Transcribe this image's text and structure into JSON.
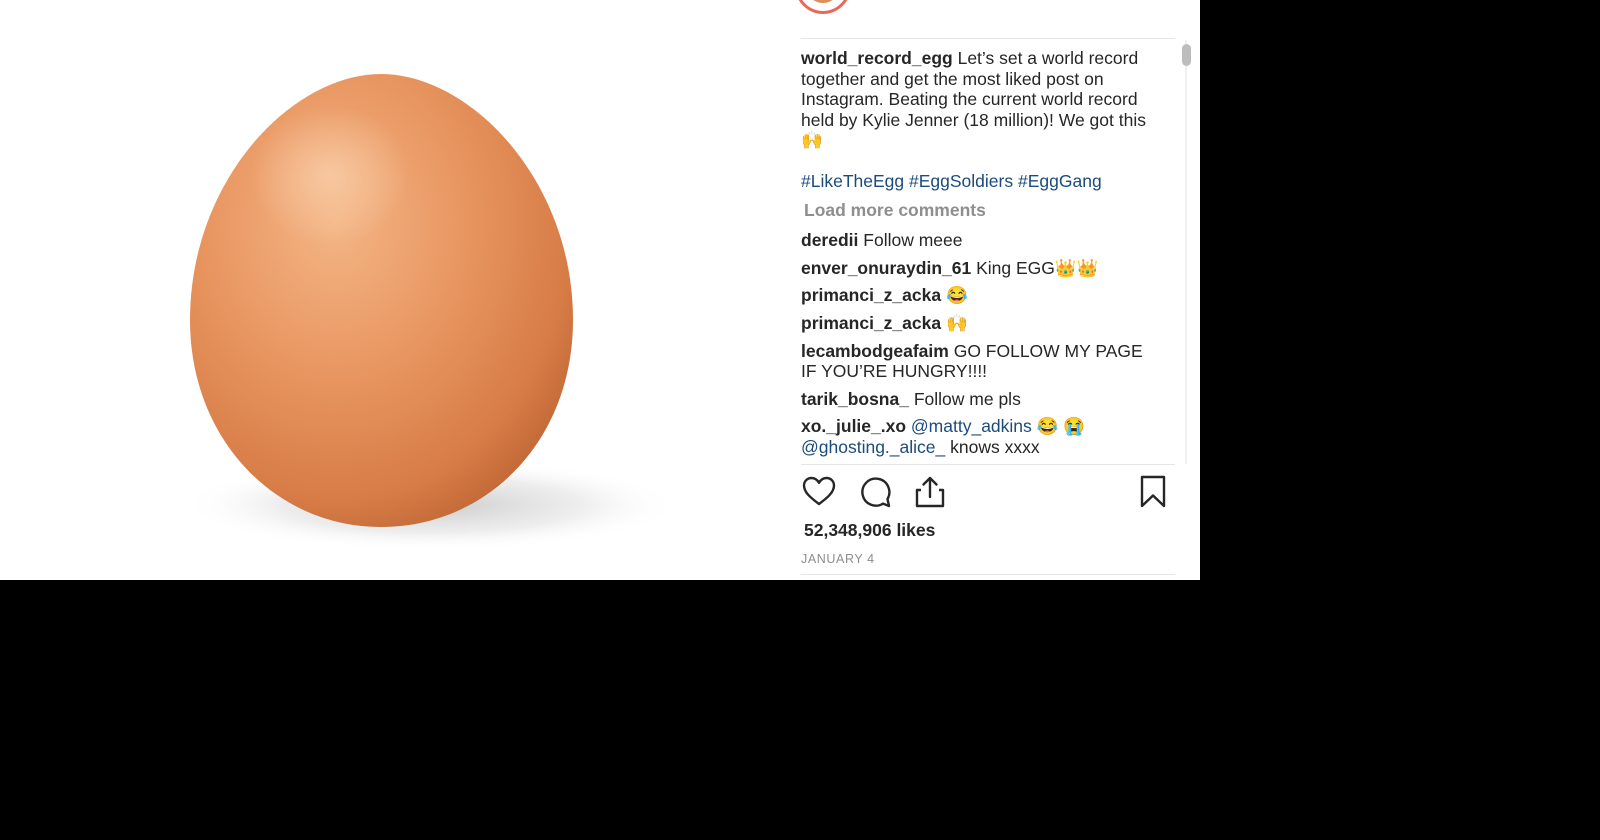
{
  "post": {
    "header_username": "world_record_egg",
    "caption": {
      "username": "world_record_egg",
      "text": "Let’s set a world record together and get the most liked post on Instagram. Beating the current world record held by Kylie Jenner (18 million)! We got this 🙌",
      "hashtags": [
        "#LikeTheEgg",
        "#EggSoldiers",
        "#EggGang"
      ]
    },
    "load_more_label": "Load more comments",
    "comments": [
      {
        "username": "deredii",
        "text": "Follow meee"
      },
      {
        "username": "enver_onuraydin_61",
        "text": "King EGG👑👑"
      },
      {
        "username": "primanci_z_acka",
        "text": "😂"
      },
      {
        "username": "primanci_z_acka",
        "text": "🙌"
      },
      {
        "username": "lecambodgeafaim",
        "text": "GO FOLLOW MY PAGE IF YOU’RE HUNGRY!!!!"
      },
      {
        "username": "tarik_bosna_",
        "text": "Follow me pls"
      },
      {
        "username": "xo._julie_.xo",
        "mention1": "@matty_adkins",
        "mid": "😂 😭",
        "mention2": "@ghosting._alice_",
        "text": "knows xxxx"
      }
    ],
    "likes": "52,348,906 likes",
    "date": "JANUARY 4"
  },
  "icons": {
    "like": "heart-outline-icon",
    "comment": "speech-bubble-icon",
    "share": "share-upload-icon",
    "save": "bookmark-icon"
  },
  "colors": {
    "egg": "#e58c58",
    "link": "#1b4b7e",
    "muted": "#8e8e8e",
    "avatar_ring": "#e9685a"
  }
}
